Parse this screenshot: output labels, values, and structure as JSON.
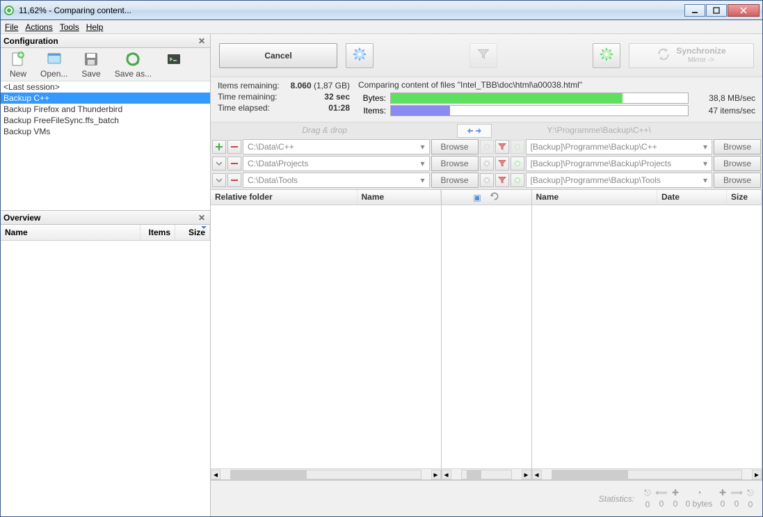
{
  "title": "11,62% - Comparing content...",
  "menu": {
    "file": "File",
    "actions": "Actions",
    "tools": "Tools",
    "help": "Help"
  },
  "config": {
    "header": "Configuration",
    "toolbar": {
      "new": "New",
      "open": "Open...",
      "save": "Save",
      "saveas": "Save as..."
    },
    "items": [
      "<Last session>",
      "Backup C++",
      "Backup Firefox and Thunderbird",
      "Backup FreeFileSync.ffs_batch",
      "Backup VMs"
    ],
    "selected_index": 1
  },
  "overview": {
    "header": "Overview",
    "cols": {
      "name": "Name",
      "items": "Items",
      "size": "Size"
    }
  },
  "toolbar": {
    "cancel": "Cancel",
    "synchronize": "Synchronize",
    "sync_sub": "Mirror ->"
  },
  "progress": {
    "items_remaining_lbl": "Items remaining:",
    "items_remaining_val": "8.060",
    "items_remaining_size": "(1,87 GB)",
    "time_remaining_lbl": "Time remaining:",
    "time_remaining_val": "32 sec",
    "time_elapsed_lbl": "Time elapsed:",
    "time_elapsed_val": "01:28",
    "file_text": "Comparing content of files \"Intel_TBB\\doc\\html\\a00038.html\"",
    "bytes_lbl": "Bytes:",
    "bytes_rate": "38,8 MB/sec",
    "items_lbl": "Items:",
    "items_rate": "47 items/sec"
  },
  "pairs": {
    "dragdrop": "Drag & drop",
    "right_header_path": "Y:\\Programme\\Backup\\C++\\",
    "browse": "Browse",
    "rows": [
      {
        "left": "C:\\Data\\C++",
        "right": "[Backup]\\Programme\\Backup\\C++"
      },
      {
        "left": "C:\\Data\\Projects",
        "right": "[Backup]\\Programme\\Backup\\Projects"
      },
      {
        "left": "C:\\Data\\Tools",
        "right": "[Backup]\\Programme\\Backup\\Tools"
      }
    ]
  },
  "grid": {
    "left_cols": {
      "folder": "Relative folder",
      "name": "Name"
    },
    "right_cols": {
      "name": "Name",
      "date": "Date",
      "size": "Size"
    }
  },
  "status": {
    "label": "Statistics:",
    "vals": [
      "0",
      "0",
      "0",
      "0 bytes",
      "0",
      "0",
      "0"
    ]
  }
}
